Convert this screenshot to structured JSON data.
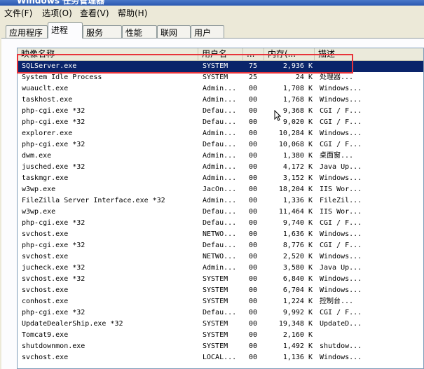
{
  "window": {
    "title": "Windows 任务管理器"
  },
  "menu": [
    {
      "label": "文件(F)"
    },
    {
      "label": "选项(O)"
    },
    {
      "label": "查看(V)"
    },
    {
      "label": "帮助(H)"
    }
  ],
  "tabs": [
    {
      "label": "应用程序",
      "active": false
    },
    {
      "label": "进程",
      "active": true
    },
    {
      "label": "服务",
      "active": false
    },
    {
      "label": "性能",
      "active": false
    },
    {
      "label": "联网",
      "active": false
    },
    {
      "label": "用户",
      "active": false
    }
  ],
  "columns": [
    {
      "label": "映像名称"
    },
    {
      "label": "用户名"
    },
    {
      "label": "..."
    },
    {
      "label": "内存(..."
    },
    {
      "label": "描述"
    }
  ],
  "processes": [
    {
      "name": "SQLServer.exe",
      "user": "SYSTEM",
      "cpu": "75",
      "mem": "2,936 K",
      "desc": "",
      "selected": true
    },
    {
      "name": "System Idle Process",
      "user": "SYSTEM",
      "cpu": "25",
      "mem": "24 K",
      "desc": "处理器...",
      "selected": false
    },
    {
      "name": "wuauclt.exe",
      "user": "Admin...",
      "cpu": "00",
      "mem": "1,708 K",
      "desc": "Windows...",
      "selected": false
    },
    {
      "name": "taskhost.exe",
      "user": "Admin...",
      "cpu": "00",
      "mem": "1,768 K",
      "desc": "Windows...",
      "selected": false
    },
    {
      "name": "php-cgi.exe *32",
      "user": "Defau...",
      "cpu": "00",
      "mem": "9,368 K",
      "desc": "CGI / F...",
      "selected": false
    },
    {
      "name": "php-cgi.exe *32",
      "user": "Defau...",
      "cpu": "00",
      "mem": "9,020 K",
      "desc": "CGI / F...",
      "selected": false
    },
    {
      "name": "explorer.exe",
      "user": "Admin...",
      "cpu": "00",
      "mem": "10,284 K",
      "desc": "Windows...",
      "selected": false
    },
    {
      "name": "php-cgi.exe *32",
      "user": "Defau...",
      "cpu": "00",
      "mem": "10,068 K",
      "desc": "CGI / F...",
      "selected": false
    },
    {
      "name": "dwm.exe",
      "user": "Admin...",
      "cpu": "00",
      "mem": "1,380 K",
      "desc": "桌面窗...",
      "selected": false
    },
    {
      "name": "jusched.exe *32",
      "user": "Admin...",
      "cpu": "00",
      "mem": "4,172 K",
      "desc": "Java Up...",
      "selected": false
    },
    {
      "name": "taskmgr.exe",
      "user": "Admin...",
      "cpu": "00",
      "mem": "3,152 K",
      "desc": "Windows...",
      "selected": false
    },
    {
      "name": "w3wp.exe",
      "user": "JacOn...",
      "cpu": "00",
      "mem": "18,204 K",
      "desc": "IIS Wor...",
      "selected": false
    },
    {
      "name": "FileZilla Server Interface.exe *32",
      "user": "Admin...",
      "cpu": "00",
      "mem": "1,336 K",
      "desc": "FileZil...",
      "selected": false
    },
    {
      "name": "w3wp.exe",
      "user": "Defau...",
      "cpu": "00",
      "mem": "11,464 K",
      "desc": "IIS Wor...",
      "selected": false
    },
    {
      "name": "php-cgi.exe *32",
      "user": "Defau...",
      "cpu": "00",
      "mem": "9,740 K",
      "desc": "CGI / F...",
      "selected": false
    },
    {
      "name": "svchost.exe",
      "user": "NETWO...",
      "cpu": "00",
      "mem": "1,636 K",
      "desc": "Windows...",
      "selected": false
    },
    {
      "name": "php-cgi.exe *32",
      "user": "Defau...",
      "cpu": "00",
      "mem": "8,776 K",
      "desc": "CGI / F...",
      "selected": false
    },
    {
      "name": "svchost.exe",
      "user": "NETWO...",
      "cpu": "00",
      "mem": "2,520 K",
      "desc": "Windows...",
      "selected": false
    },
    {
      "name": "jucheck.exe *32",
      "user": "Admin...",
      "cpu": "00",
      "mem": "3,580 K",
      "desc": "Java Up...",
      "selected": false
    },
    {
      "name": "svchost.exe *32",
      "user": "SYSTEM",
      "cpu": "00",
      "mem": "6,840 K",
      "desc": "Windows...",
      "selected": false
    },
    {
      "name": "svchost.exe",
      "user": "SYSTEM",
      "cpu": "00",
      "mem": "6,704 K",
      "desc": "Windows...",
      "selected": false
    },
    {
      "name": "conhost.exe",
      "user": "SYSTEM",
      "cpu": "00",
      "mem": "1,224 K",
      "desc": "控制台...",
      "selected": false
    },
    {
      "name": "php-cgi.exe *32",
      "user": "Defau...",
      "cpu": "00",
      "mem": "9,992 K",
      "desc": "CGI / F...",
      "selected": false
    },
    {
      "name": "UpdateDealerShip.exe *32",
      "user": "SYSTEM",
      "cpu": "00",
      "mem": "19,348 K",
      "desc": "UpdateD...",
      "selected": false
    },
    {
      "name": "Tomcat9.exe",
      "user": "SYSTEM",
      "cpu": "00",
      "mem": "2,160 K",
      "desc": "",
      "selected": false
    },
    {
      "name": "shutdownmon.exe",
      "user": "SYSTEM",
      "cpu": "00",
      "mem": "1,492 K",
      "desc": "shutdow...",
      "selected": false
    },
    {
      "name": "svchost.exe",
      "user": "LOCAL...",
      "cpu": "00",
      "mem": "1,136 K",
      "desc": "Windows...",
      "selected": false
    }
  ],
  "colors": {
    "selection": "#0a246a",
    "annotation_box": "#e8343b"
  },
  "icons": {
    "cursor": "mouse-pointer-icon"
  }
}
